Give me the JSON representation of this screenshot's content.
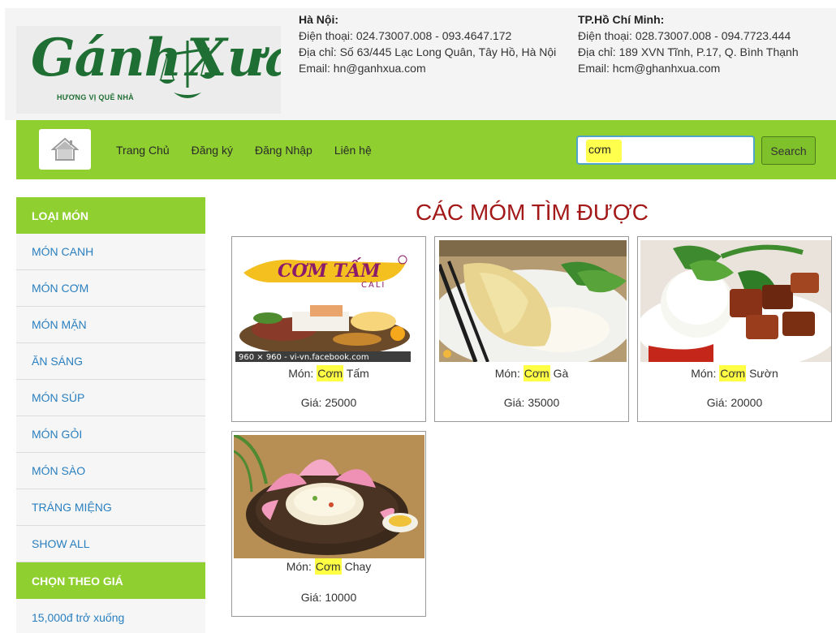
{
  "header": {
    "logo": {
      "brand": "Gánh",
      "brand_x": "Xưa",
      "tagline": "HƯƠNG VỊ QUÊ NHÀ"
    },
    "branches": [
      {
        "name": "Hà Nội:",
        "phone": "Điện thoại: 024.73007.008 - 093.4647.172",
        "address": "Địa chỉ: Số 63/445 Lạc Long Quân, Tây Hồ, Hà Nội",
        "email": "Email: hn@ganhxua.com"
      },
      {
        "name": "TP.Hồ Chí Minh:",
        "phone": "Điện thoại: 028.73007.008 - 094.7723.444",
        "address": "Địa chỉ: 189 XVN Tĩnh, P.17, Q. Bình Thạnh",
        "email": "Email: hcm@ghanhxua.com"
      }
    ]
  },
  "navbar": {
    "links": [
      "Trang Chủ",
      "Đăng ký",
      "Đăng Nhập",
      "Liên hệ"
    ],
    "search_value": "cơm",
    "search_button": "Search",
    "accent": "#8fcf2f"
  },
  "sidebar": {
    "category_title": "LOẠI MÓN",
    "categories": [
      "MÓN CANH",
      "MÓN CƠM",
      "MÓN MẶN",
      "ĂN SÁNG",
      "MÓN SÚP",
      "MÓN GỎI",
      "MÓN SÀO",
      "TRÁNG MIỆNG",
      "SHOW ALL"
    ],
    "price_title": "CHỌN THEO GIÁ",
    "price_options": [
      "15,000đ trở xuống"
    ]
  },
  "main": {
    "title": "CÁC MÓM TÌM ĐƯỢC",
    "dishes": [
      {
        "prefix": "Món: ",
        "match": "Cơm",
        "rest": " Tấm",
        "price": "Giá: 25000",
        "image_caption": "CƠM TẤM",
        "image_sub": "CALI",
        "image_watermark": "960 × 960 - vi-vn.facebook.com"
      },
      {
        "prefix": "Món: ",
        "match": "Cơm",
        "rest": " Gà",
        "price": "Giá: 35000"
      },
      {
        "prefix": "Món: ",
        "match": "Cơm",
        "rest": " Sườn",
        "price": "Giá: 20000"
      },
      {
        "prefix": "Món: ",
        "match": "Cơm",
        "rest": " Chay",
        "price": "Giá: 10000"
      }
    ]
  }
}
